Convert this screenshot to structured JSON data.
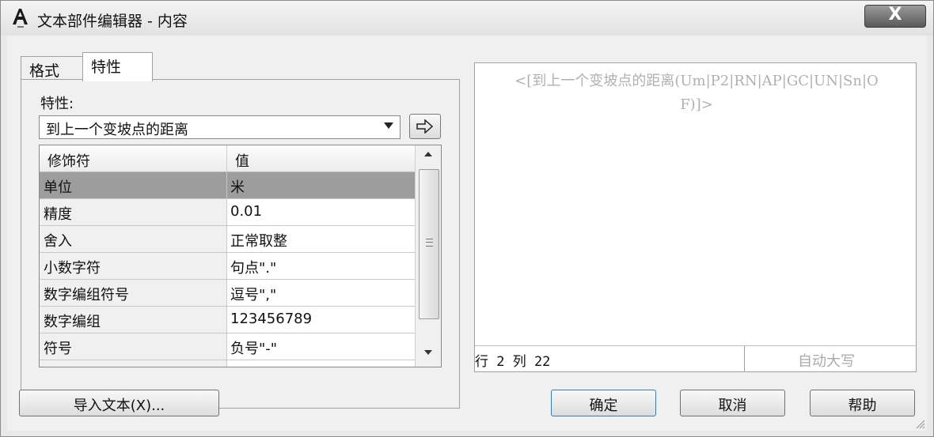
{
  "window": {
    "title": "文本部件编辑器 - 内容",
    "close_label": "X"
  },
  "tabs": [
    {
      "label": "格式"
    },
    {
      "label": "特性"
    }
  ],
  "properties": {
    "label": "特性:",
    "selected": "到上一个变坡点的距离"
  },
  "grid": {
    "headers": {
      "modifier": "修饰符",
      "value": "值"
    },
    "rows": [
      {
        "name": "单位",
        "value": "米"
      },
      {
        "name": "精度",
        "value": "0.01"
      },
      {
        "name": "舍入",
        "value": "正常取整"
      },
      {
        "name": "小数字符",
        "value": "句点\".\""
      },
      {
        "name": "数字编组符号",
        "value": "逗号\",\""
      },
      {
        "name": "数字编组",
        "value": "123456789"
      },
      {
        "name": "符号",
        "value": "负号\"-\""
      }
    ],
    "selected_row": 0
  },
  "preview": {
    "text": "<[到上一个变坡点的距离(Um|P2|RN|AP|GC|UN|Sn|OF)]>"
  },
  "status": {
    "position": "行 2 列 22",
    "caps": "自动大写"
  },
  "buttons": {
    "import": "导入文本(X)...",
    "ok": "确定",
    "cancel": "取消",
    "help": "帮助"
  },
  "colors": {
    "selected_row_bg": "#9d9d9d",
    "preview_text": "#b0b0b0"
  }
}
